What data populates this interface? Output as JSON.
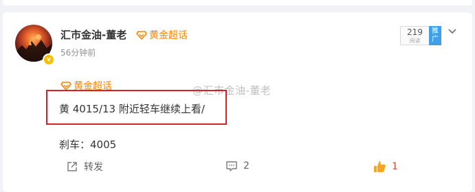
{
  "post": {
    "username": "汇市金油-董老",
    "topic_label": "黄金超话",
    "timestamp": "56分钟前",
    "read_count": "219",
    "read_label": "阅读",
    "promote_label": "推广",
    "body_topic": "黄金超话",
    "main_text": "黄 4015/13 附近轻车继续上看/",
    "second_text": "刹车：4005",
    "watermark": "@汇市金油-董老"
  },
  "actions": {
    "share_label": "转发",
    "comment_count": "2",
    "like_count": "1"
  },
  "colors": {
    "accent_orange": "#ff8200",
    "highlight_red": "#d81f26",
    "like_red": "#e8432c",
    "promote_blue": "#3fa0e9"
  }
}
